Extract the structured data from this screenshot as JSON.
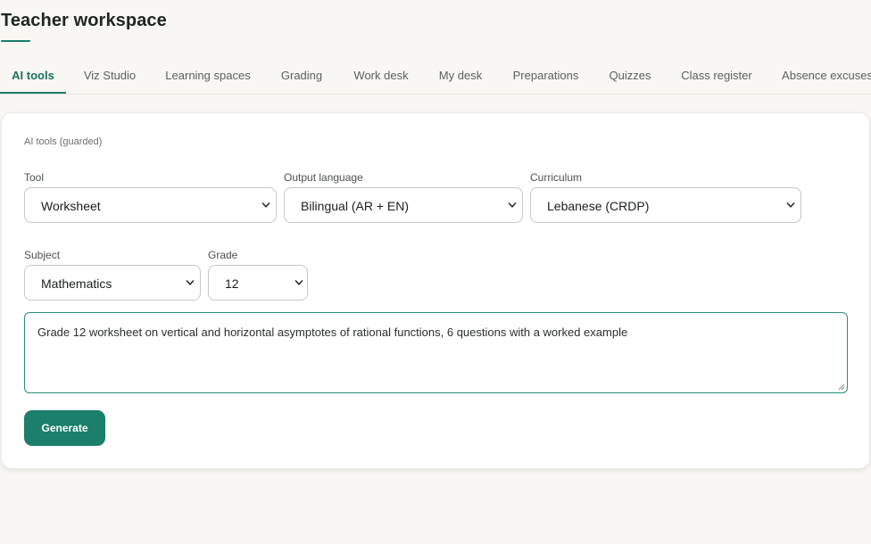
{
  "header": {
    "title": "Teacher workspace"
  },
  "tabs": [
    {
      "label": "AI tools",
      "active": true
    },
    {
      "label": "Viz Studio",
      "active": false
    },
    {
      "label": "Learning spaces",
      "active": false
    },
    {
      "label": "Grading",
      "active": false
    },
    {
      "label": "Work desk",
      "active": false
    },
    {
      "label": "My desk",
      "active": false
    },
    {
      "label": "Preparations",
      "active": false
    },
    {
      "label": "Quizzes",
      "active": false
    },
    {
      "label": "Class register",
      "active": false
    },
    {
      "label": "Absence excuses",
      "active": false
    }
  ],
  "panel": {
    "caption": "AI tools (guarded)",
    "tool": {
      "label": "Tool",
      "value": "Worksheet"
    },
    "output_language": {
      "label": "Output language",
      "value": "Bilingual (AR + EN)"
    },
    "curriculum": {
      "label": "Curriculum",
      "value": "Lebanese (CRDP)"
    },
    "subject": {
      "label": "Subject",
      "value": "Mathematics"
    },
    "grade": {
      "label": "Grade",
      "value": "12"
    },
    "prompt": {
      "value": "Grade 12 worksheet on vertical and horizontal asymptotes of rational functions, 6 questions with a worked example"
    },
    "generate_label": "Generate"
  },
  "colors": {
    "accent": "#1b7f6b",
    "background": "#f8f7f3",
    "card": "#ffffff"
  }
}
